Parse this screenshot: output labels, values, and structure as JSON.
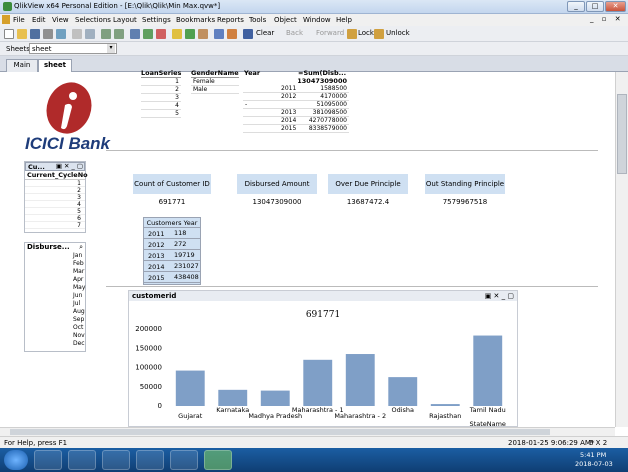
{
  "window": {
    "title": "QlikView x64 Personal Edition - [E:\\Qlik\\Qlik\\Min Max.qvw*]",
    "min": "_",
    "max": "□",
    "close": "✕",
    "restore": "_ ▫ ✕"
  },
  "menu": [
    "File",
    "Edit",
    "View",
    "Selections",
    "Layout",
    "Settings",
    "Bookmarks",
    "Reports",
    "Tools",
    "Object",
    "Window",
    "Help"
  ],
  "toolbar": {
    "clear": "Clear",
    "back": "Back",
    "forward": "Forward",
    "lock": "Lock",
    "unlock": "Unlock"
  },
  "sheets": {
    "label": "Sheets",
    "value": "sheet"
  },
  "tabs": [
    "Main",
    "sheet"
  ],
  "logo": {
    "text": "ICICI Bank",
    "color": "#b02a2a"
  },
  "cycle_listbox": {
    "title": "Cu...",
    "field": "Current_CycleNo",
    "values": [
      "1",
      "2",
      "3",
      "4",
      "5",
      "6",
      "7"
    ]
  },
  "disburse_listbox": {
    "title": "Disburse...",
    "values": [
      "Jan",
      "Feb",
      "Mar",
      "Apr",
      "May",
      "Jun",
      "Jul",
      "Aug",
      "Sep",
      "Oct",
      "Nov",
      "Dec"
    ]
  },
  "loan_series": {
    "header": "LoanSeries",
    "values": [
      "1",
      "2",
      "3",
      "4",
      "5"
    ]
  },
  "gender": {
    "header": "GenderName",
    "values": [
      "Female",
      "Male"
    ]
  },
  "year_table": {
    "col1": "Year",
    "col2": "=Sum(Disb...",
    "total": "13047309000",
    "rows": [
      {
        "year": "2011",
        "value": "1588500"
      },
      {
        "year": "2012",
        "value": "4170000"
      },
      {
        "year": "-",
        "value": "51095000"
      },
      {
        "year": "2013",
        "value": "381098500"
      },
      {
        "year": "2014",
        "value": "4270778000"
      },
      {
        "year": "2015",
        "value": "8338579000"
      }
    ]
  },
  "kpis": [
    {
      "label": "Count of Customer ID",
      "value": "691771"
    },
    {
      "label": "Disbursed Amount",
      "value": "13047309000"
    },
    {
      "label": "Over Due Principle",
      "value": "13687472.4"
    },
    {
      "label": "Out Standing Principle",
      "value": "7579967518"
    }
  ],
  "customers_year": {
    "header": "Customers Year",
    "rows": [
      {
        "year": "2011",
        "count": "118"
      },
      {
        "year": "2012",
        "count": "272"
      },
      {
        "year": "2013",
        "count": "19719"
      },
      {
        "year": "2014",
        "count": "231027"
      },
      {
        "year": "2015",
        "count": "438408"
      }
    ]
  },
  "chart_title_bar": "customerid",
  "chart_data": {
    "type": "bar",
    "title": "691771",
    "categories": [
      "Gujarat",
      "Karnataka",
      "Madhya Pradesh",
      "Maharashtra - 1",
      "Maharashtra - 2",
      "Odisha",
      "Rajasthan",
      "Tamil Nadu"
    ],
    "values": [
      92000,
      42000,
      40000,
      120000,
      135000,
      75000,
      5000,
      183000
    ],
    "ylim": [
      0,
      200000
    ],
    "yticks": [
      "0",
      "50000",
      "100000",
      "150000",
      "200000"
    ],
    "xlabel": "StateName",
    "bar_color": "#7f9fc7"
  },
  "status": {
    "left": "For Help, press F1",
    "datetime": "2018-01-25 9:06:29 AM*",
    "size": "6 X 2"
  },
  "taskbar": {
    "time": "5:41 PM",
    "date": "2018-07-03"
  }
}
